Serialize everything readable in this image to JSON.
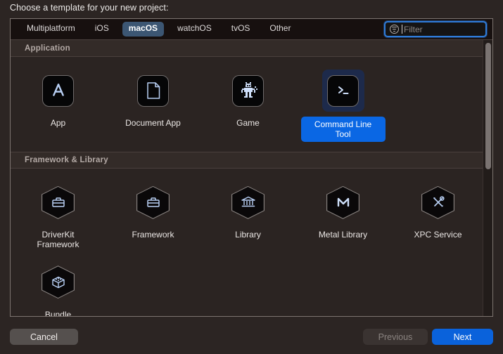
{
  "dialog": {
    "title": "Choose a template for your new project:"
  },
  "tabs": [
    {
      "label": "Multiplatform",
      "selected": false
    },
    {
      "label": "iOS",
      "selected": false
    },
    {
      "label": "macOS",
      "selected": true
    },
    {
      "label": "watchOS",
      "selected": false
    },
    {
      "label": "tvOS",
      "selected": false
    },
    {
      "label": "Other",
      "selected": false
    }
  ],
  "filter": {
    "placeholder": "Filter",
    "value": "",
    "icon": "filter-icon",
    "focused": true
  },
  "sections": [
    {
      "title": "Application",
      "items": [
        {
          "label": "App",
          "icon": "app-store-icon",
          "selected": false
        },
        {
          "label": "Document App",
          "icon": "document-icon",
          "selected": false
        },
        {
          "label": "Game",
          "icon": "game-sprite-icon",
          "selected": false
        },
        {
          "label": "Command Line Tool",
          "icon": "terminal-icon",
          "selected": true
        }
      ]
    },
    {
      "title": "Framework & Library",
      "items": [
        {
          "label": "DriverKit Framework",
          "icon": "toolbox-hex-icon",
          "selected": false
        },
        {
          "label": "Framework",
          "icon": "toolbox-hex-icon",
          "selected": false
        },
        {
          "label": "Library",
          "icon": "bank-hex-icon",
          "selected": false
        },
        {
          "label": "Metal Library",
          "icon": "metal-hex-icon",
          "selected": false
        },
        {
          "label": "XPC Service",
          "icon": "tools-hex-icon",
          "selected": false
        },
        {
          "label": "Bundle",
          "icon": "cube-hex-icon",
          "selected": false
        }
      ]
    }
  ],
  "footer": {
    "cancel": "Cancel",
    "previous": "Previous",
    "next": "Next"
  },
  "colors": {
    "accent": "#0a62db",
    "tab_selected": "#3c5673",
    "focus_ring": "#2f7bd8",
    "window_bg": "#2c2523",
    "panel_bg": "#2b2422",
    "icon_blue": "#b9d0f5"
  }
}
